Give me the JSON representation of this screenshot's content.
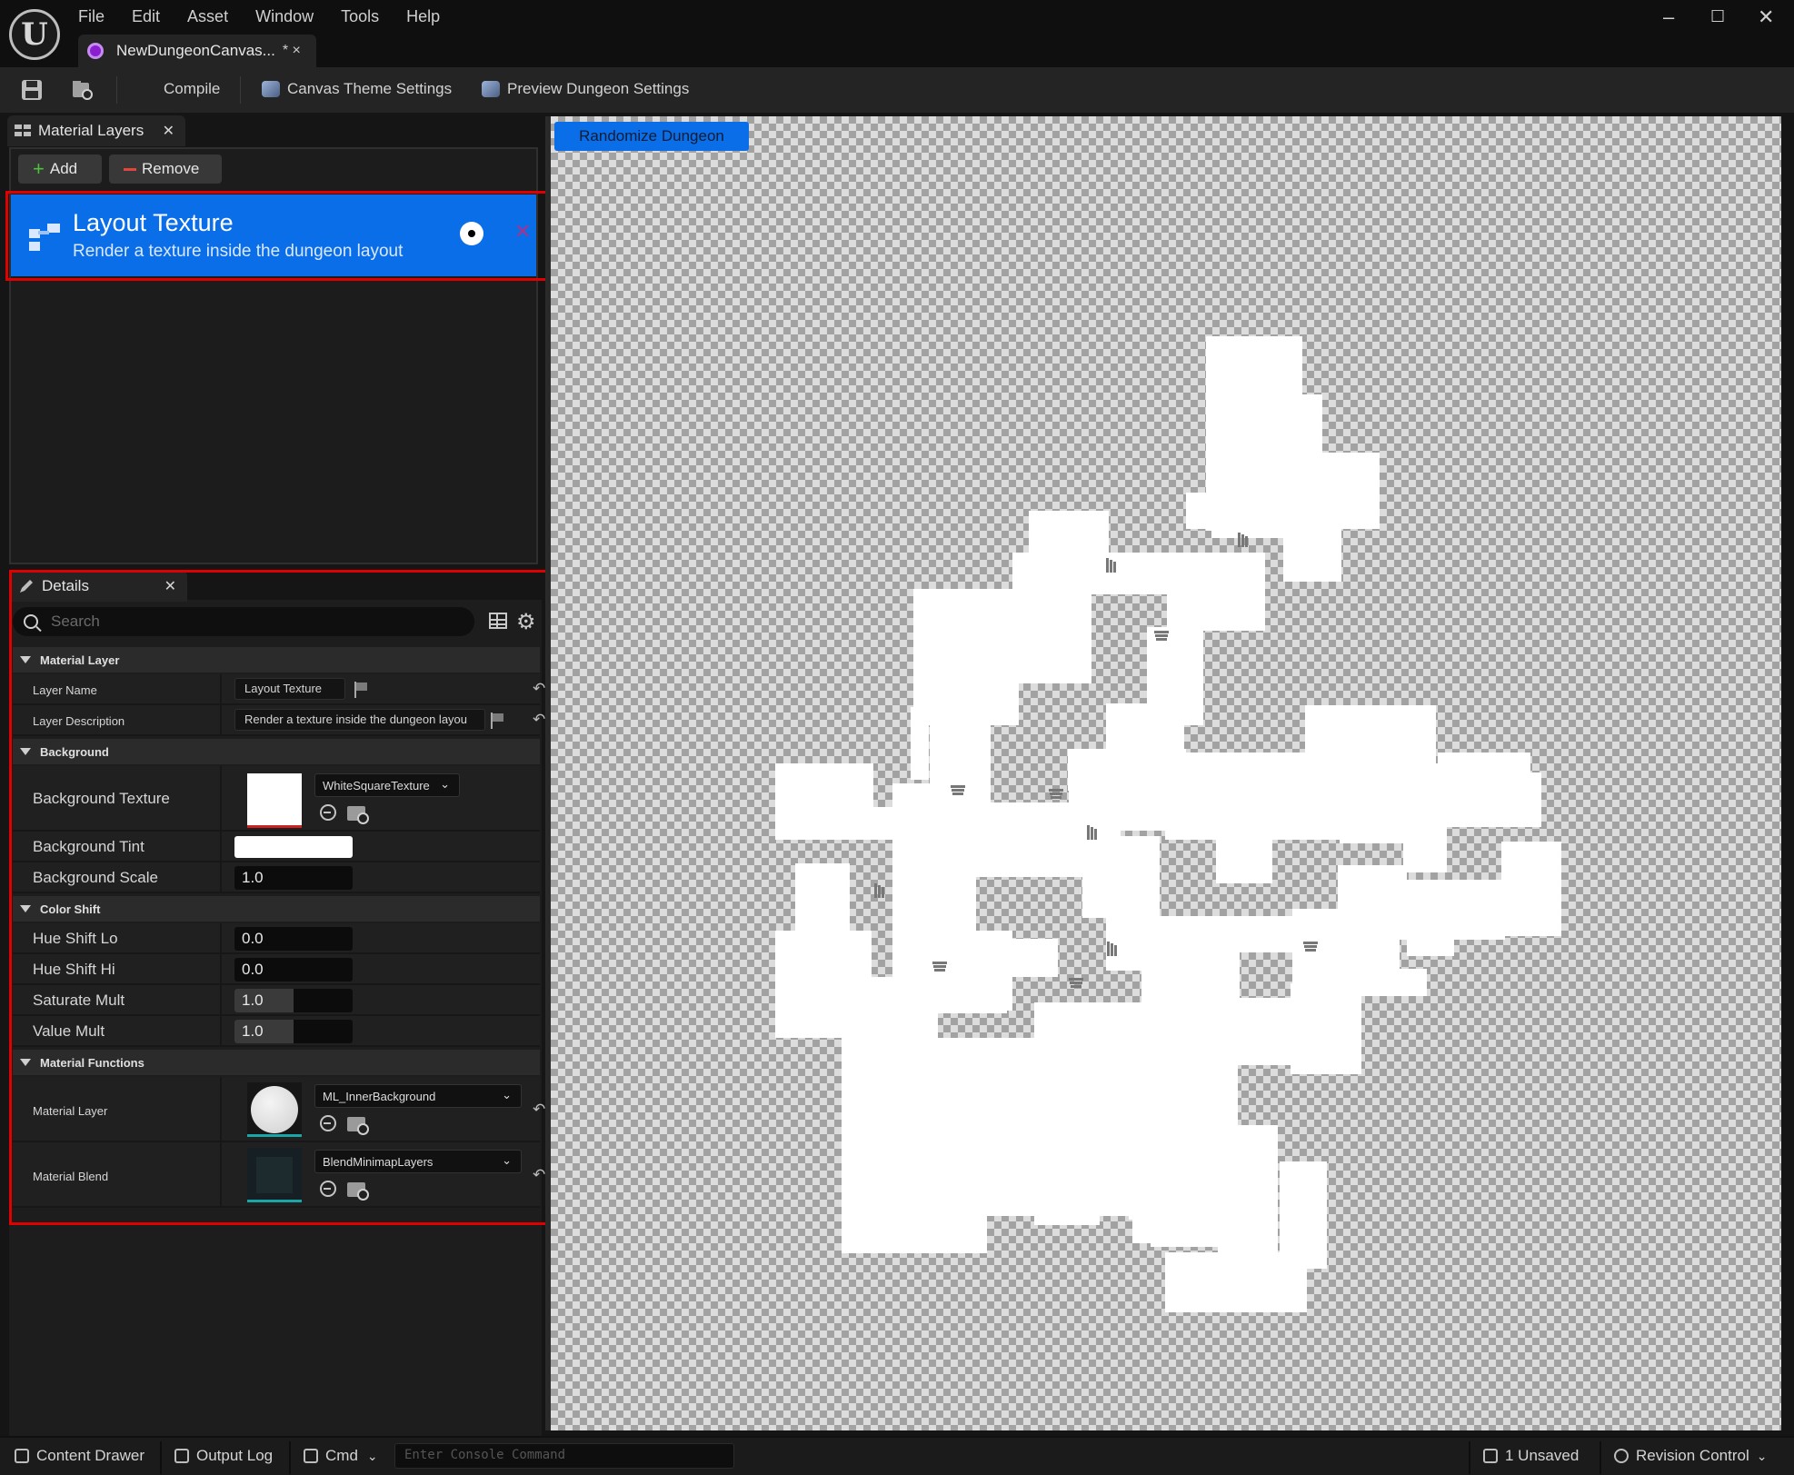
{
  "menu": [
    "File",
    "Edit",
    "Asset",
    "Window",
    "Tools",
    "Help"
  ],
  "document_tab": {
    "name": "NewDungeonCanvas...",
    "modified": "* ×"
  },
  "toolbar": {
    "compile": "Compile",
    "canvas_theme": "Canvas Theme Settings",
    "preview_dungeon": "Preview Dungeon Settings"
  },
  "material_layers": {
    "tab_title": "Material Layers",
    "add_label": "Add",
    "remove_label": "Remove",
    "items": [
      {
        "title": "Layout Texture",
        "description": "Render a texture inside the dungeon layout"
      }
    ]
  },
  "details": {
    "tab_title": "Details",
    "search_placeholder": "Search",
    "categories": {
      "material_layer": "Material Layer",
      "background": "Background",
      "color_shift": "Color Shift",
      "material_functions": "Material Functions"
    },
    "layer_name": {
      "label": "Layer Name",
      "value": "Layout Texture"
    },
    "layer_description": {
      "label": "Layer Description",
      "value": "Render a texture inside the dungeon layou"
    },
    "background_texture": {
      "label": "Background Texture",
      "value": "WhiteSquareTexture"
    },
    "background_tint": {
      "label": "Background Tint",
      "color": "#ffffff"
    },
    "background_scale": {
      "label": "Background Scale",
      "value": "1.0"
    },
    "hue_shift_lo": {
      "label": "Hue Shift Lo",
      "value": "0.0"
    },
    "hue_shift_hi": {
      "label": "Hue Shift Hi",
      "value": "0.0"
    },
    "saturate_mult": {
      "label": "Saturate Mult",
      "value": "1.0",
      "fill": 0.5
    },
    "value_mult": {
      "label": "Value Mult",
      "value": "1.0",
      "fill": 0.5
    },
    "material_layer": {
      "label": "Material Layer",
      "value": "ML_InnerBackground"
    },
    "material_blend": {
      "label": "Material Blend",
      "value": "BlendMinimapLayers"
    }
  },
  "viewport": {
    "randomize_label": "Randomize Dungeon"
  },
  "statusbar": {
    "content_drawer": "Content Drawer",
    "output_log": "Output Log",
    "cmd": "Cmd",
    "console_placeholder": "Enter Console Command",
    "unsaved": "1 Unsaved",
    "revision_control": "Revision Control"
  },
  "colors": {
    "accent": "#0a6ee8",
    "highlight": "#e00000",
    "panel": "#1d1d1d"
  },
  "icons": [
    "ue-logo-icon",
    "save-icon",
    "browse-icon",
    "eye-icon",
    "gear-icon",
    "grid-icon",
    "reset-icon",
    "flag-icon"
  ]
}
